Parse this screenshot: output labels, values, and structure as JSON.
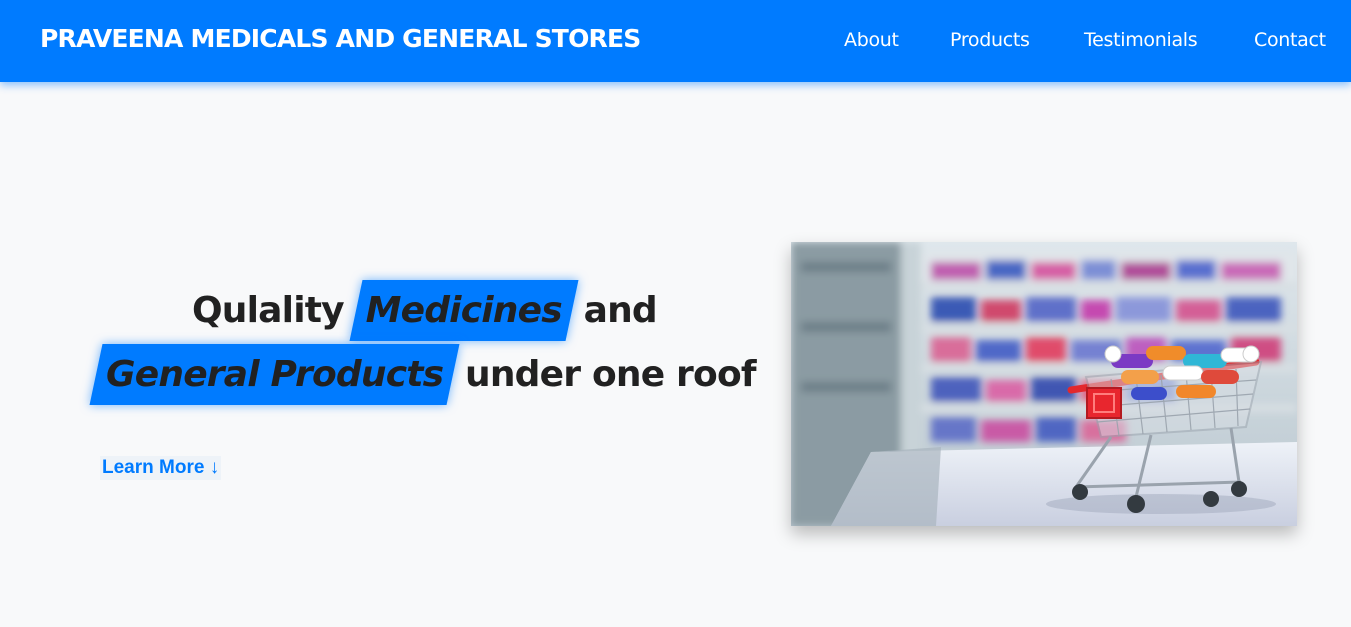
{
  "navbar": {
    "brand": "PRAVEENA MEDICALS AND GENERAL STORES",
    "links": [
      "About",
      "Products",
      "Testimonials",
      "Contact"
    ]
  },
  "hero": {
    "line1_pre": "Qulality",
    "line1_highlight": "Medicines",
    "line1_post": "and",
    "line2_highlight": "General Products",
    "line2_post": "under one roof",
    "cta_label": "Learn More ↓",
    "image_alt": "Shopping cart filled with medicine capsules in a pharmacy"
  },
  "colors": {
    "primary": "#007bff",
    "background": "#f8f9fa",
    "heading_text": "#212121",
    "cart_accent": "#e8262e"
  }
}
